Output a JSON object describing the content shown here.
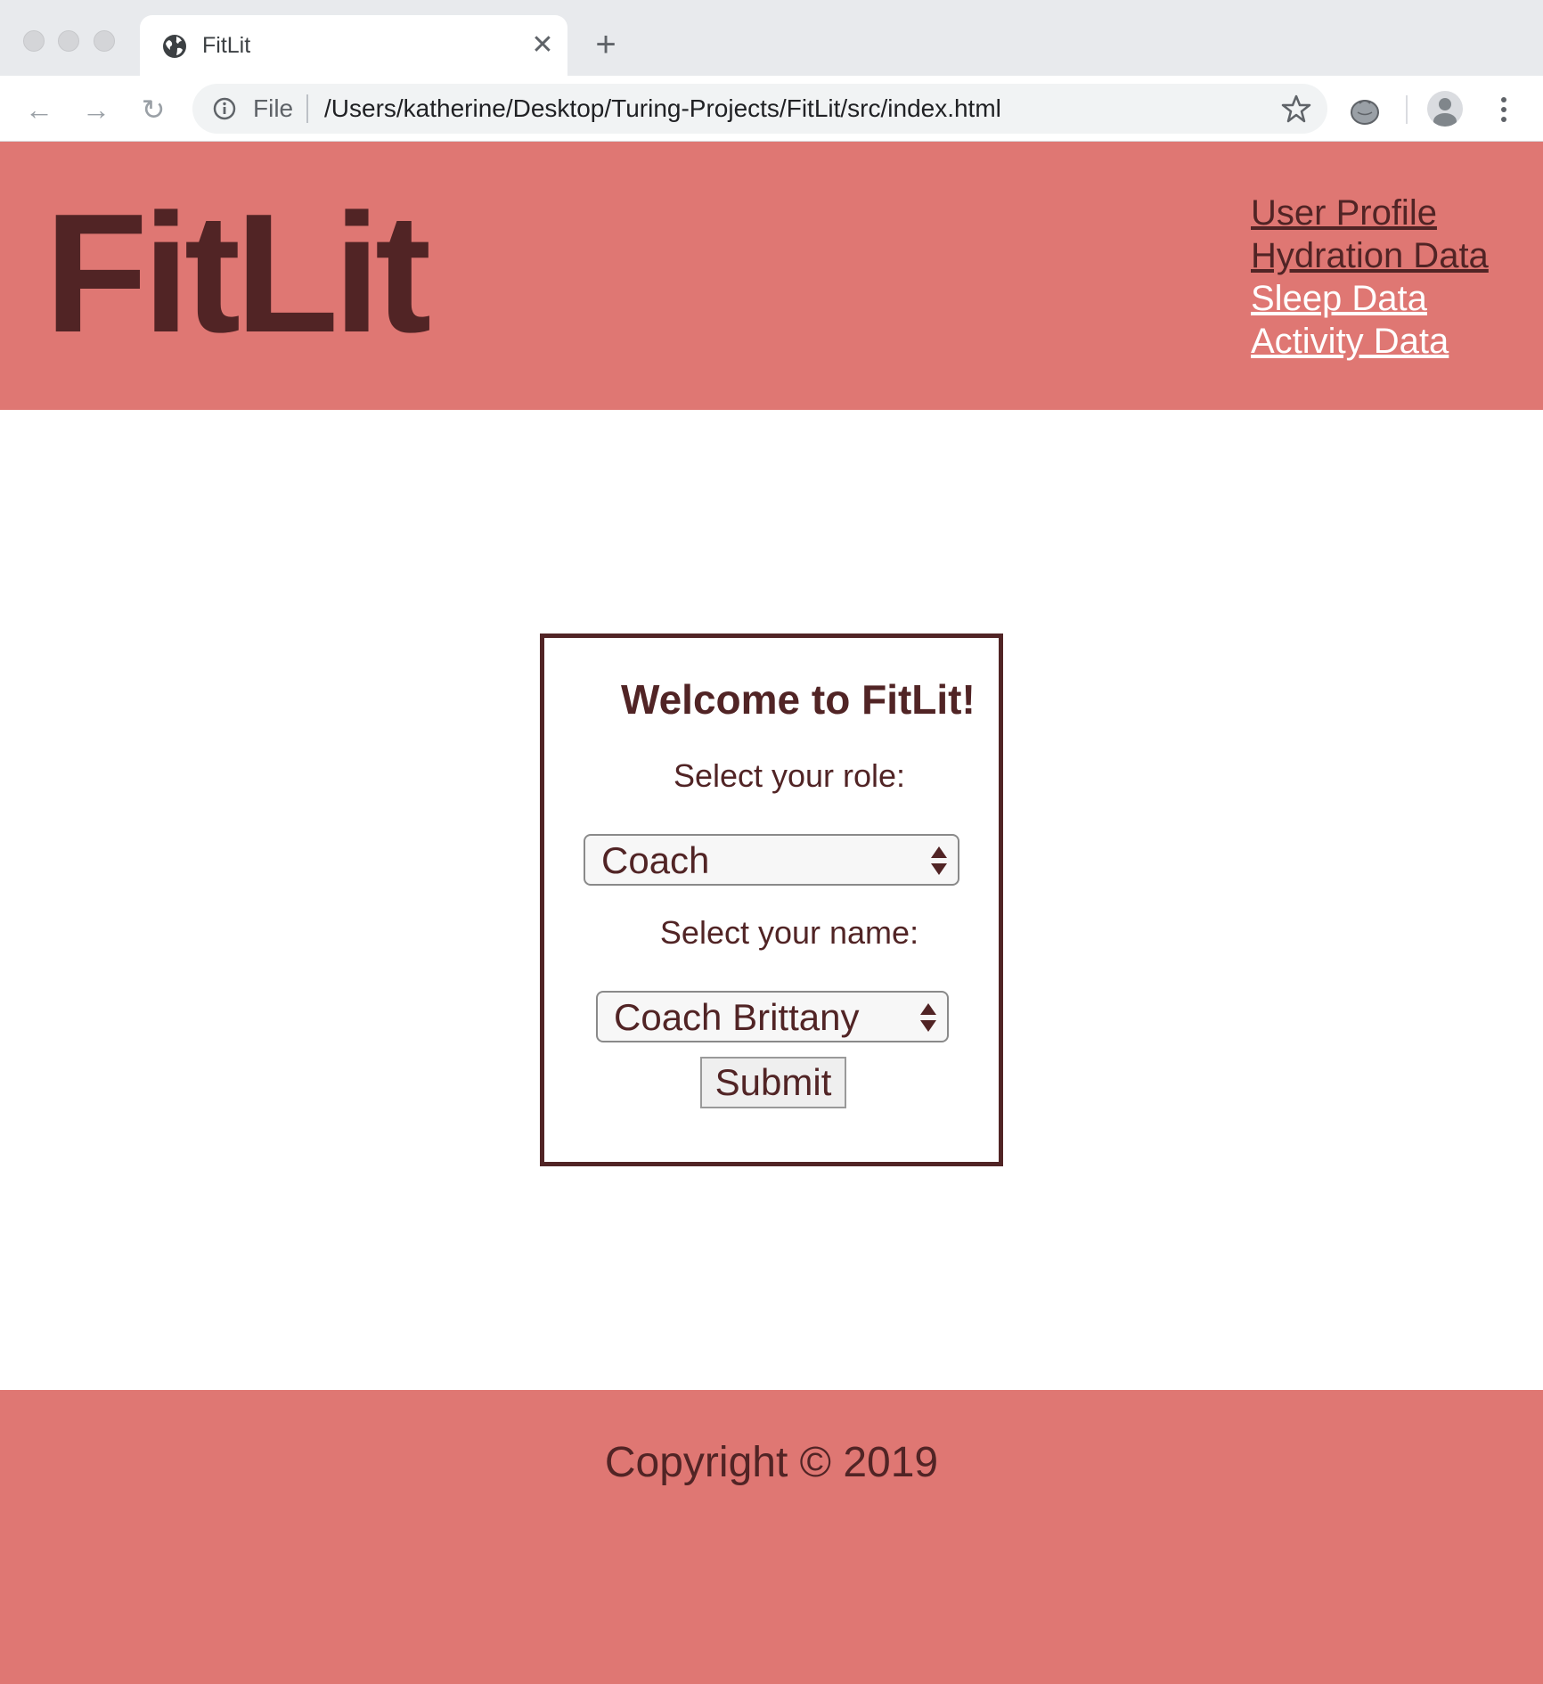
{
  "browser": {
    "tab_title": "FitLit",
    "address_scheme_label": "File",
    "address_url": "/Users/katherine/Desktop/Turing-Projects/FitLit/src/index.html"
  },
  "header": {
    "logo": "FitLit",
    "nav": [
      {
        "label": "User Profile"
      },
      {
        "label": "Hydration Data"
      },
      {
        "label": "Sleep Data"
      },
      {
        "label": "Activity Data"
      }
    ]
  },
  "login_card": {
    "title": "Welcome to FitLit!",
    "role_prompt": "Select your role:",
    "role_selected": "Coach",
    "name_prompt": "Select your name:",
    "name_selected": "Coach Brittany",
    "submit_label": "Submit"
  },
  "footer": {
    "copyright": "Copyright © 2019"
  },
  "colors": {
    "accent": "#df7773",
    "text_dark": "#512425",
    "nav_light": "#ffffff"
  },
  "icons": [
    "globe-icon",
    "close-icon",
    "plus-icon",
    "back-icon",
    "forward-icon",
    "reload-icon",
    "info-icon",
    "star-icon",
    "extension-icon",
    "avatar-icon",
    "more-menu-icon",
    "select-arrows-icon"
  ]
}
